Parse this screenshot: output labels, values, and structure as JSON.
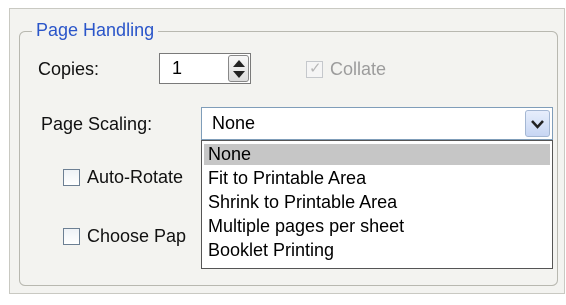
{
  "group": {
    "title": "Page Handling"
  },
  "copies": {
    "label": "Copies:",
    "value": "1"
  },
  "collate": {
    "label": "Collate",
    "checked": true,
    "enabled": false
  },
  "page_scaling": {
    "label": "Page Scaling:",
    "value": "None",
    "options": [
      "None",
      "Fit to Printable Area",
      "Shrink to Printable Area",
      "Multiple pages per sheet",
      "Booklet Printing"
    ],
    "selected_index": 0
  },
  "auto_rotate": {
    "label": "Auto-Rotate"
  },
  "choose_paper": {
    "label": "Choose Pap"
  },
  "icons": {
    "spinner": "up-down-arrows-icon",
    "dropdown": "chevron-down-icon",
    "check": "checkmark-icon"
  }
}
